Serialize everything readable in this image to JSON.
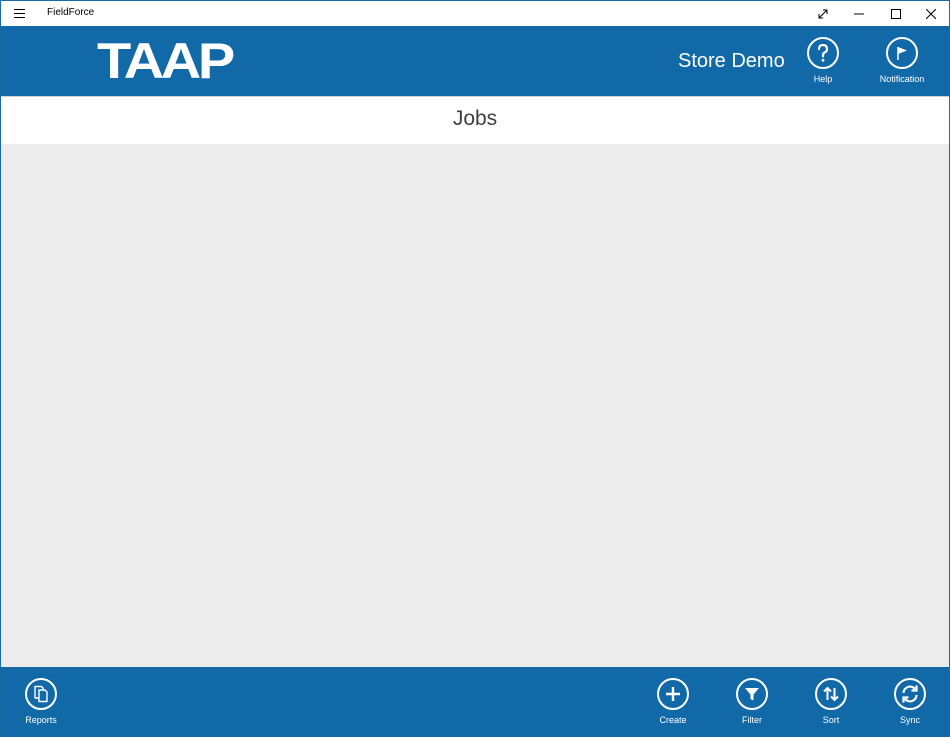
{
  "window": {
    "title": "FieldForce"
  },
  "header": {
    "logo_text": "TAAP",
    "store_name": "Store Demo",
    "help_label": "Help",
    "notification_label": "Notification"
  },
  "page": {
    "title": "Jobs"
  },
  "toolbar": {
    "reports_label": "Reports",
    "create_label": "Create",
    "filter_label": "Filter",
    "sort_label": "Sort",
    "sync_label": "Sync"
  },
  "colors": {
    "brand_blue": "#1269a8",
    "content_bg": "#ececec"
  },
  "icons": {
    "menu": "hamburger-icon",
    "expand": "expand-icon",
    "minimize": "minimize-icon",
    "maximize": "maximize-icon",
    "close": "close-icon",
    "help": "question-icon",
    "notification": "flag-icon",
    "reports": "documents-icon",
    "create": "plus-icon",
    "filter": "funnel-icon",
    "sort": "sort-arrows-icon",
    "sync": "sync-icon"
  }
}
